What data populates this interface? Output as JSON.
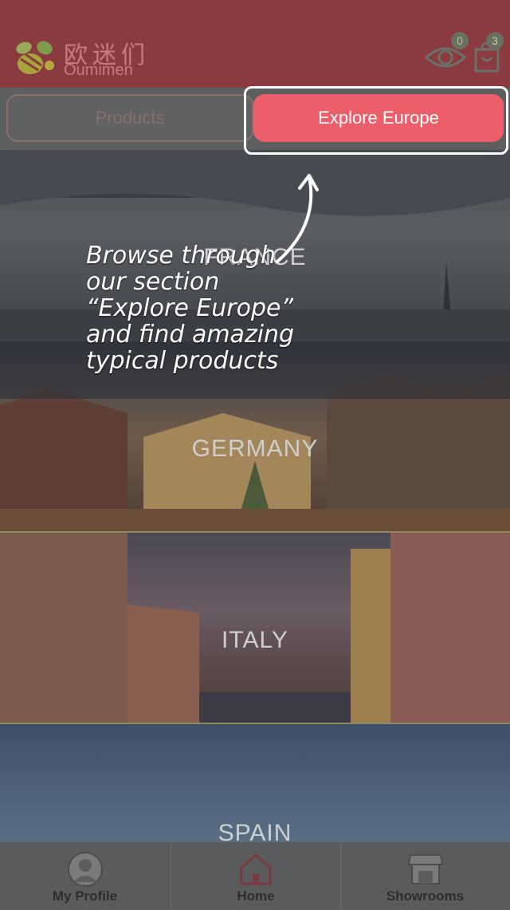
{
  "header": {
    "logo_cn": "欧迷们",
    "logo_en": "Oumimen",
    "viewed_count": "0",
    "cart_count": "3"
  },
  "tabs": [
    {
      "label": "Products",
      "active": false
    },
    {
      "label": "Explore Europe",
      "active": true
    }
  ],
  "countries": [
    {
      "label": "FRANCE"
    },
    {
      "label": "GERMANY"
    },
    {
      "label": "ITALY"
    },
    {
      "label": "SPAIN"
    }
  ],
  "tooltip": {
    "lines": [
      "Browse through",
      "our section",
      "“Explore Europe”",
      "and find amazing",
      "typical products"
    ]
  },
  "bottom_nav": [
    {
      "label": "My Profile"
    },
    {
      "label": "Home"
    },
    {
      "label": "Showrooms"
    }
  ],
  "colors": {
    "header_bg": "#8a3b40",
    "accent": "#eb5e6a",
    "overlay_text": "#ffffff"
  },
  "icons": [
    "bee-logo-icon",
    "eye-icon",
    "shopping-bag-icon",
    "avatar-icon",
    "home-icon",
    "storefront-icon",
    "curved-arrow-icon"
  ]
}
